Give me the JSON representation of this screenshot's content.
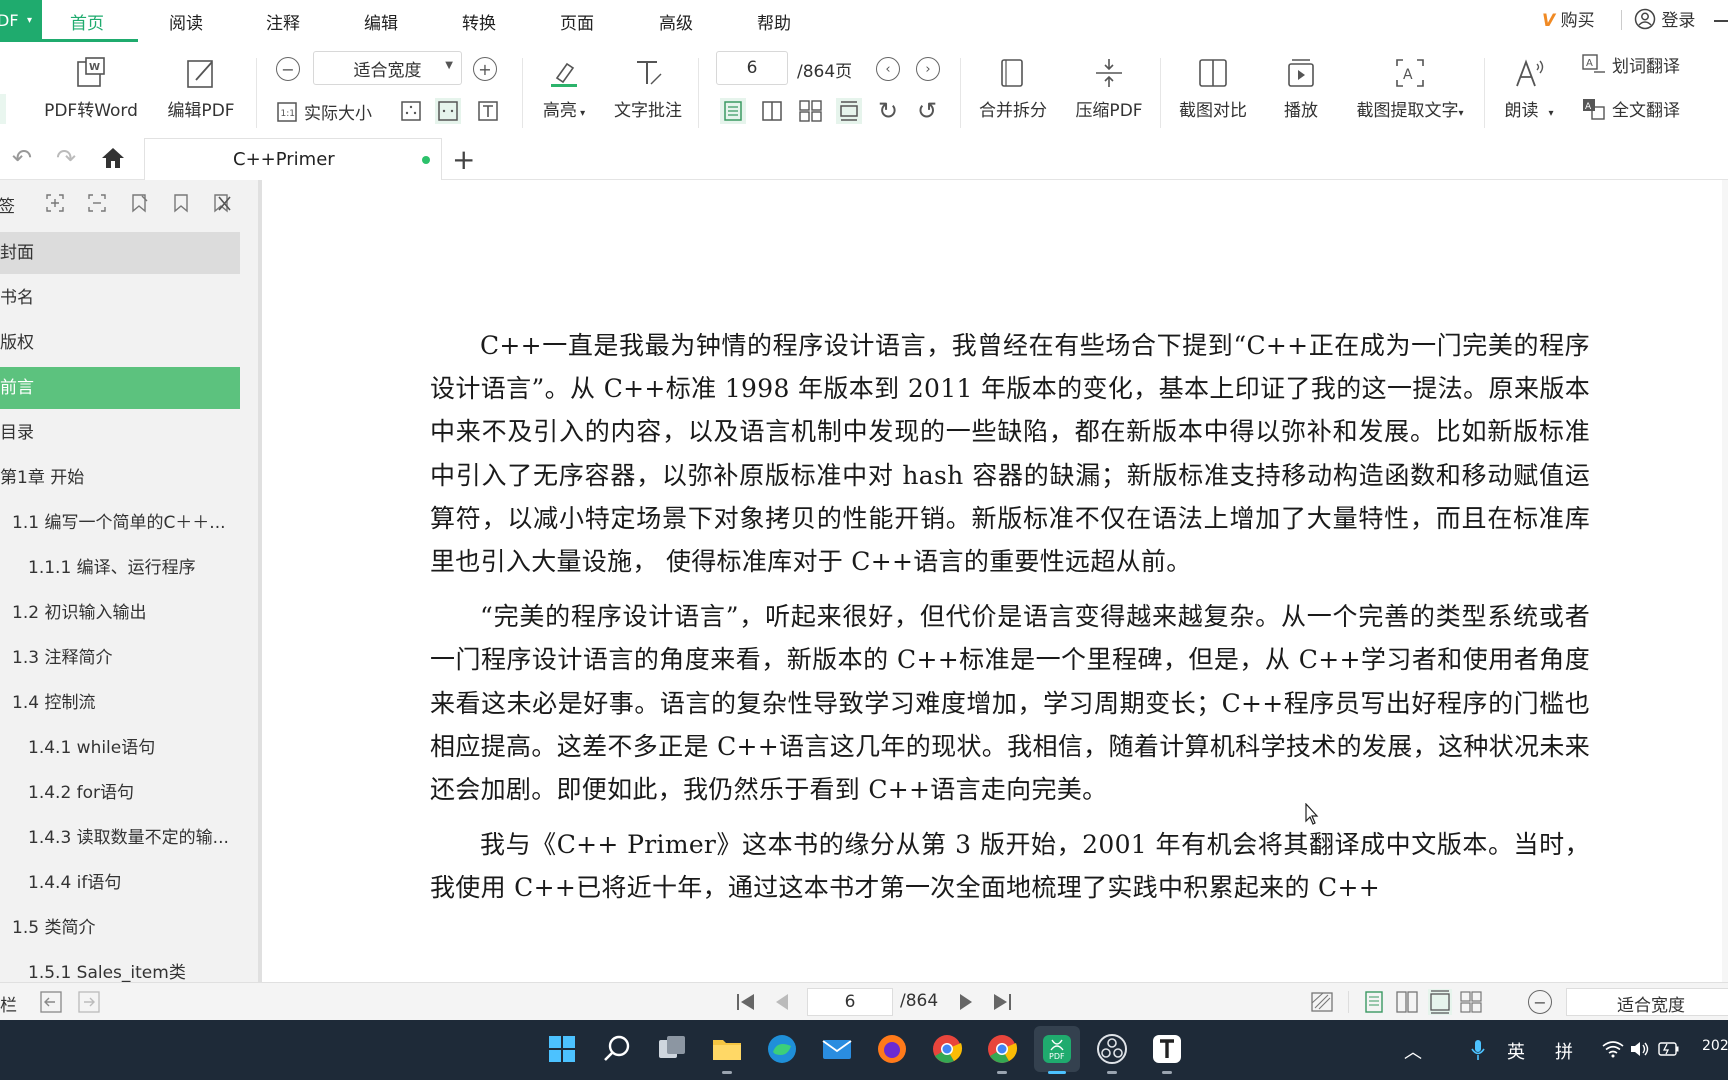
{
  "app": {
    "badge": "DF"
  },
  "menu": [
    "首页",
    "阅读",
    "注释",
    "编辑",
    "转换",
    "页面",
    "高级",
    "帮助"
  ],
  "topright": {
    "buy": "购买",
    "login": "登录"
  },
  "ribbon": {
    "pdf_to_word": "PDF转Word",
    "edit_pdf": "编辑PDF",
    "zoom_value": "适合宽度",
    "actual_size": "实际大小",
    "highlight": "高亮",
    "text_note": "文字批注",
    "page_value": "6",
    "page_total": "/864页",
    "merge_split": "合并拆分",
    "compress_pdf": "压缩PDF",
    "screenshot_compare": "截图对比",
    "play": "播放",
    "ocr_extract": "截图提取文字",
    "read_aloud": "朗读",
    "word_translate": "划词翻译",
    "full_translate": "全文翻译"
  },
  "tab": {
    "title": "C++Primer"
  },
  "sidebar": {
    "title": "签",
    "items": [
      {
        "label": "封面",
        "indent": 0,
        "state": "grey"
      },
      {
        "label": "书名",
        "indent": 0,
        "state": ""
      },
      {
        "label": "版权",
        "indent": 0,
        "state": ""
      },
      {
        "label": "前言",
        "indent": 0,
        "state": "green"
      },
      {
        "label": "目录",
        "indent": 0,
        "state": ""
      },
      {
        "label": "第1章  开始",
        "indent": 0,
        "state": ""
      },
      {
        "label": "1.1  编写一个简单的C＋＋...",
        "indent": 1,
        "state": ""
      },
      {
        "label": "1.1.1  编译、运行程序",
        "indent": 2,
        "state": ""
      },
      {
        "label": "1.2  初识输入输出",
        "indent": 1,
        "state": ""
      },
      {
        "label": "1.3  注释简介",
        "indent": 1,
        "state": ""
      },
      {
        "label": "1.4  控制流",
        "indent": 1,
        "state": ""
      },
      {
        "label": "1.4.1  while语句",
        "indent": 2,
        "state": ""
      },
      {
        "label": "1.4.2  for语句",
        "indent": 2,
        "state": ""
      },
      {
        "label": "1.4.3  读取数量不定的输...",
        "indent": 2,
        "state": ""
      },
      {
        "label": "1.4.4  if语句",
        "indent": 2,
        "state": ""
      },
      {
        "label": "1.5  类简介",
        "indent": 1,
        "state": ""
      },
      {
        "label": "1.5.1  Sales_item类",
        "indent": 2,
        "state": ""
      }
    ]
  },
  "document": {
    "paragraphs": [
      "C++一直是我最为钟情的程序设计语言，我曾经在有些场合下提到“C++正在成为一门完美的程序设计语言”。从 C++标准 1998 年版本到 2011 年版本的变化，基本上印证了我的这一提法。原来版本中来不及引入的内容，以及语言机制中发现的一些缺陷，都在新版本中得以弥补和发展。比如新版标准中引入了无序容器，以弥补原版标准中对 hash 容器的缺漏；新版标准支持移动构造函数和移动赋值运算符，以减小特定场景下对象拷贝的性能开销。新版标准不仅在语法上增加了大量特性，而且在标准库里也引入大量设施， 使得标准库对于 C++语言的重要性远超从前。",
      "“完美的程序设计语言”，听起来很好，但代价是语言变得越来越复杂。从一个完善的类型系统或者一门程序设计语言的角度来看，新版本的 C++标准是一个里程碑，但是，从 C++学习者和使用者角度来看这未必是好事。语言的复杂性导致学习难度增加，学习周期变长；C++程序员写出好程序的门槛也相应提高。这差不多正是 C++语言这几年的现状。我相信，随着计算机科学技术的发展，这种状况未来还会加剧。即便如此，我仍然乐于看到 C++语言走向完美。",
      "我与《C++ Primer》这本书的缘分从第 3 版开始，2001 年有机会将其翻译成中文版本。当时，我使用 C++已将近十年，通过这本书才第一次全面地梳理了实践中积累起来的 C++"
    ]
  },
  "statusbar": {
    "left_label": "栏",
    "page_value": "6",
    "page_total": "/864",
    "zoom": "适合宽度"
  },
  "taskbar": {
    "ime_lang": "英",
    "ime_mode": "拼",
    "clock": "202"
  },
  "colors": {
    "accent": "#1fab6e",
    "selected": "#5cc27e",
    "taskbar": "#1e2a38"
  }
}
